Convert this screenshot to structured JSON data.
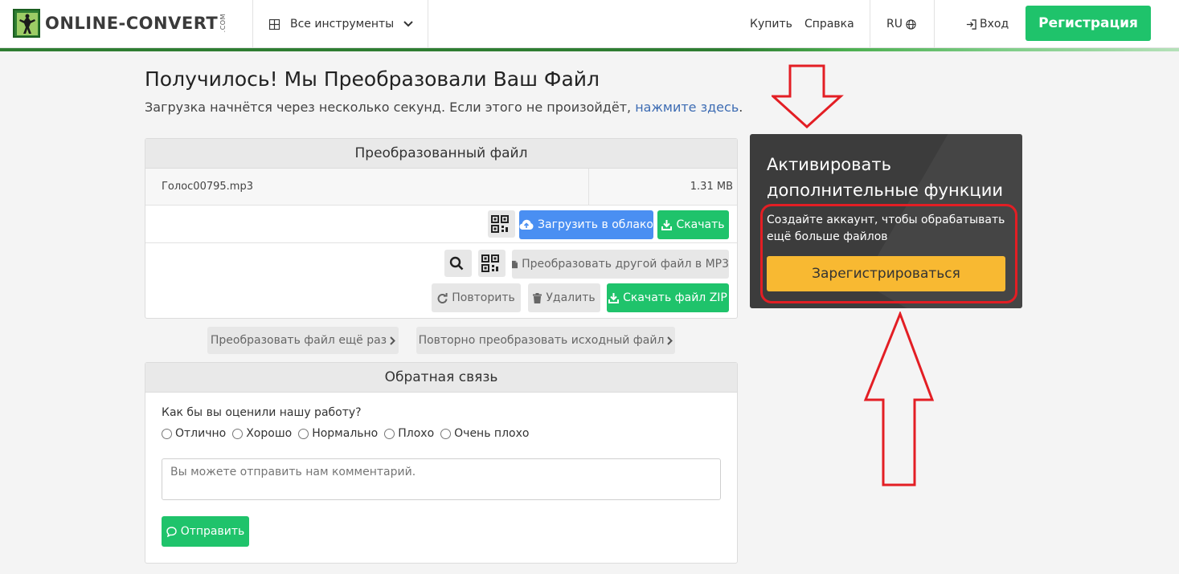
{
  "header": {
    "logo_text": "ONLINE-CONVERT",
    "logo_suffix": ".COM",
    "tools_label": "Все инструменты",
    "buy_label": "Купить",
    "help_label": "Справка",
    "lang_label": "RU",
    "login_label": "Вход",
    "signup_label": "Регистрация"
  },
  "result": {
    "title": "Получилось! Мы Преобразовали Ваш Файл",
    "subtitle": "Загрузка начнётся через несколько секунд. Если этого не произойдёт, ",
    "subtitle_link": "нажмите здесь",
    "subtitle_end": "."
  },
  "converted_panel": {
    "heading": "Преобразованный файл",
    "file_name": "Голос00795.mp3",
    "file_size": "1.31 MB",
    "cloud_upload_label": "Загрузить в облако",
    "download_label": "Скачать",
    "convert_other_label": "Преобразовать другой файл в MP3",
    "retry_label": "Повторить",
    "delete_label": "Удалить",
    "download_zip_label": "Скачать файл ZIP"
  },
  "links": {
    "convert_again_label": "Преобразовать файл ещё раз",
    "reconvert_source_label": "Повторно преобразовать исходный файл"
  },
  "feedback": {
    "heading": "Обратная связь",
    "question": "Как бы вы оценили нашу работу?",
    "options": [
      "Отлично",
      "Хорошо",
      "Нормально",
      "Плохо",
      "Очень плохо"
    ],
    "comment_placeholder": "Вы можете отправить нам комментарий.",
    "send_label": "Отправить"
  },
  "promo": {
    "title": "Активировать дополнительные функции",
    "text": "Создайте аккаунт, чтобы обрабатывать ещё больше файлов",
    "button_label": "Зарегистрироваться"
  },
  "colors": {
    "brand_green": "#1fc36b",
    "cloud_blue": "#4a8ff2",
    "promo_yellow": "#f8b932",
    "annotation_red": "#e31e24"
  }
}
